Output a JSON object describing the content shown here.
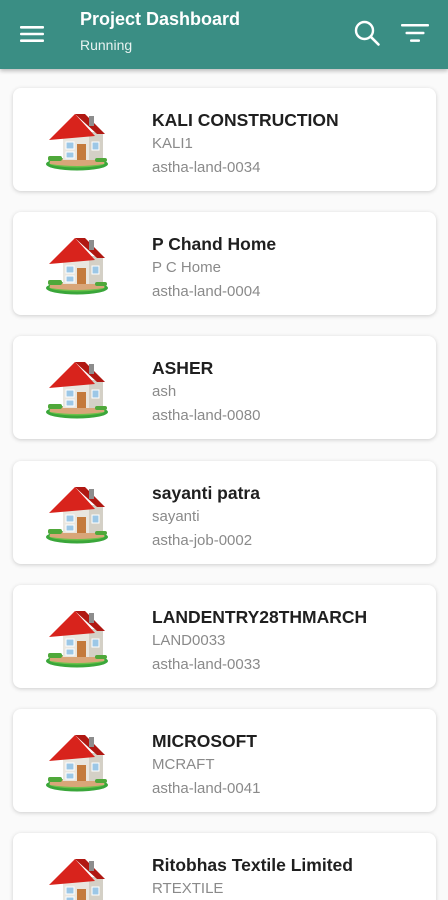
{
  "app_bar": {
    "title": "Project Dashboard",
    "subtitle": "Running",
    "color": "#3a8e84",
    "icons": [
      "menu-icon",
      "search-icon",
      "filter-icon"
    ]
  },
  "projects": [
    {
      "name": "KALI CONSTRUCTION",
      "code": "KALI1",
      "ref": "astha-land-0034"
    },
    {
      "name": "P Chand Home",
      "code": "P C Home",
      "ref": "astha-land-0004"
    },
    {
      "name": "ASHER",
      "code": "ash",
      "ref": "astha-land-0080"
    },
    {
      "name": "sayanti patra",
      "code": "sayanti",
      "ref": "astha-job-0002"
    },
    {
      "name": "LANDENTRY28THMARCH",
      "code": "LAND0033",
      "ref": "astha-land-0033"
    },
    {
      "name": "MICROSOFT",
      "code": "MCRAFT",
      "ref": "astha-land-0041"
    },
    {
      "name": "Ritobhas Textile Limited",
      "code": "RTEXTILE",
      "ref": ""
    }
  ]
}
